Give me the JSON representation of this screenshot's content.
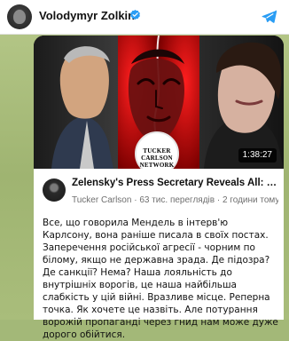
{
  "header": {
    "channel_name": "Volodymyr Zolkin",
    "verified_icon": "verified-badge",
    "share_icon": "telegram-share-icon"
  },
  "video": {
    "duration": "1:38:27",
    "logo_text": {
      "line1": "TUCKER",
      "line2": "CARLSON",
      "line3": "NETWORK"
    },
    "title": "Zelensky's Press Secretary Reveals All: Cocaine, Cover-ups, and the Only Obstacle Pr...",
    "subtitle": "Tucker Carlson · 63 тис. переглядів · 2 години тому"
  },
  "post": {
    "text": "Все, що говорила Мендель в інтерв'ю Карлсону, вона раніше писала в своїх постах. Заперечення російської агресії - чорним по білому, якщо не державна зрада. Де підозра? Де санкції? Нема? Наша лояльність до внутрішніх ворогів, це наша найбільша слабкість у цій війні. Вразливе місце. Реперна точка. Як хочете це назвіть. Але потурання ворожій пропаганді через гнид нам може дуже дорого обійтися."
  },
  "colors": {
    "accent_blue": "#2a9df4",
    "chat_bg": "#a3b878"
  }
}
